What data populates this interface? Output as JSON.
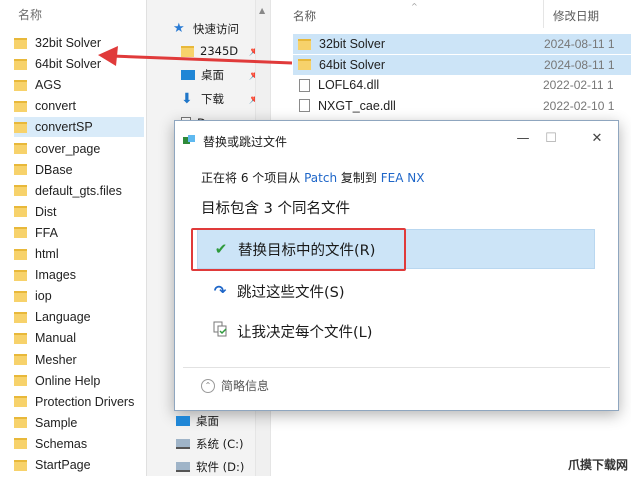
{
  "left_pane": {
    "header": "名称",
    "folders": [
      "32bit Solver",
      "64bit Solver",
      "AGS",
      "convert",
      "convertSP",
      "cover_page",
      "DBase",
      "default_gts.files",
      "Dist",
      "FFA",
      "html",
      "Images",
      "iop",
      "Language",
      "Manual",
      "Mesher",
      "Online Help",
      "Protection Drivers",
      "Sample",
      "Schemas",
      "StartPage"
    ],
    "selected_index": 4
  },
  "nav_pane": {
    "quick_access": "快速访问",
    "items": [
      {
        "label": "2345D",
        "icon": "folder-icon"
      },
      {
        "label": "桌面",
        "icon": "desktop-icon"
      },
      {
        "label": "下载",
        "icon": "download-icon"
      },
      {
        "label": "Docu",
        "icon": "document-icon"
      }
    ],
    "bottom_items": [
      {
        "label": "桌面",
        "icon": "desktop-icon"
      },
      {
        "label": "系统 (C:)",
        "icon": "drive-icon"
      },
      {
        "label": "软件 (D:)",
        "icon": "drive-icon"
      }
    ]
  },
  "file_list": {
    "col_name": "名称",
    "col_date": "修改日期",
    "files": [
      {
        "name": "32bit Solver",
        "date": "2024-08-11 1",
        "type": "folder",
        "selected": true
      },
      {
        "name": "64bit Solver",
        "date": "2024-08-11 1",
        "type": "folder",
        "selected": true
      },
      {
        "name": "LOFL64.dll",
        "date": "2022-02-11 1",
        "type": "dll",
        "selected": false
      },
      {
        "name": "NXGT_cae.dll",
        "date": "2022-02-10 1",
        "type": "dll",
        "selected": false
      }
    ]
  },
  "dialog": {
    "title": "替换或跳过文件",
    "progress_prefix": "正在将 6 个项目从",
    "source": "Patch",
    "progress_mid": "复制到",
    "dest": "FEA NX",
    "heading": "目标包含 3 个同名文件",
    "options": [
      {
        "label": "替换目标中的文件(R)",
        "icon": "check-icon"
      },
      {
        "label": "跳过这些文件(S)",
        "icon": "skip-icon"
      },
      {
        "label": "让我决定每个文件(L)",
        "icon": "decide-icon"
      }
    ],
    "details": "简略信息",
    "minimize": "—",
    "maximize": "☐",
    "close": "✕"
  },
  "watermark": "爪摸下载网",
  "colors": {
    "accent": "#1e66c8",
    "highlight": "#cce4f7",
    "annotation_red": "#e03a3a"
  }
}
